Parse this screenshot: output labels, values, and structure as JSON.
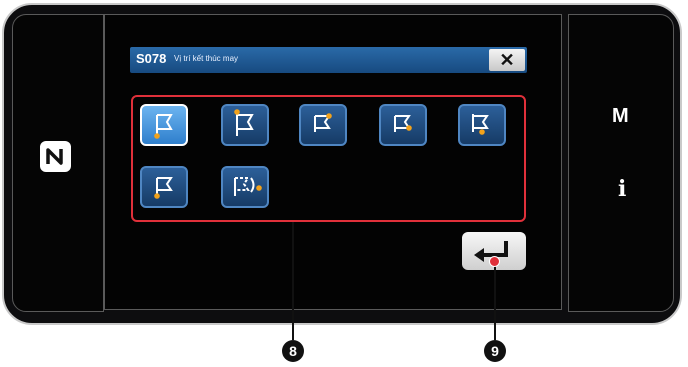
{
  "dialog": {
    "code": "S078",
    "title": "Vị trí kết thúc may",
    "close_label": "✕"
  },
  "side_buttons": {
    "m_label": "M",
    "i_label": "i"
  },
  "options": [
    {
      "name": "end-position-option-1",
      "selected": true
    },
    {
      "name": "end-position-option-2",
      "selected": false
    },
    {
      "name": "end-position-option-3",
      "selected": false
    },
    {
      "name": "end-position-option-4",
      "selected": false
    },
    {
      "name": "end-position-option-5",
      "selected": false
    },
    {
      "name": "end-position-option-6",
      "selected": false
    },
    {
      "name": "end-position-option-7",
      "selected": false
    }
  ],
  "enter_icon": "enter-arrow-icon",
  "callouts": {
    "a": "8",
    "b": "9"
  },
  "colors": {
    "accent": "#e0303a",
    "button_blue": "#1f4f87",
    "selected_blue": "#4a9ae0",
    "marker": "#f2a21b"
  }
}
